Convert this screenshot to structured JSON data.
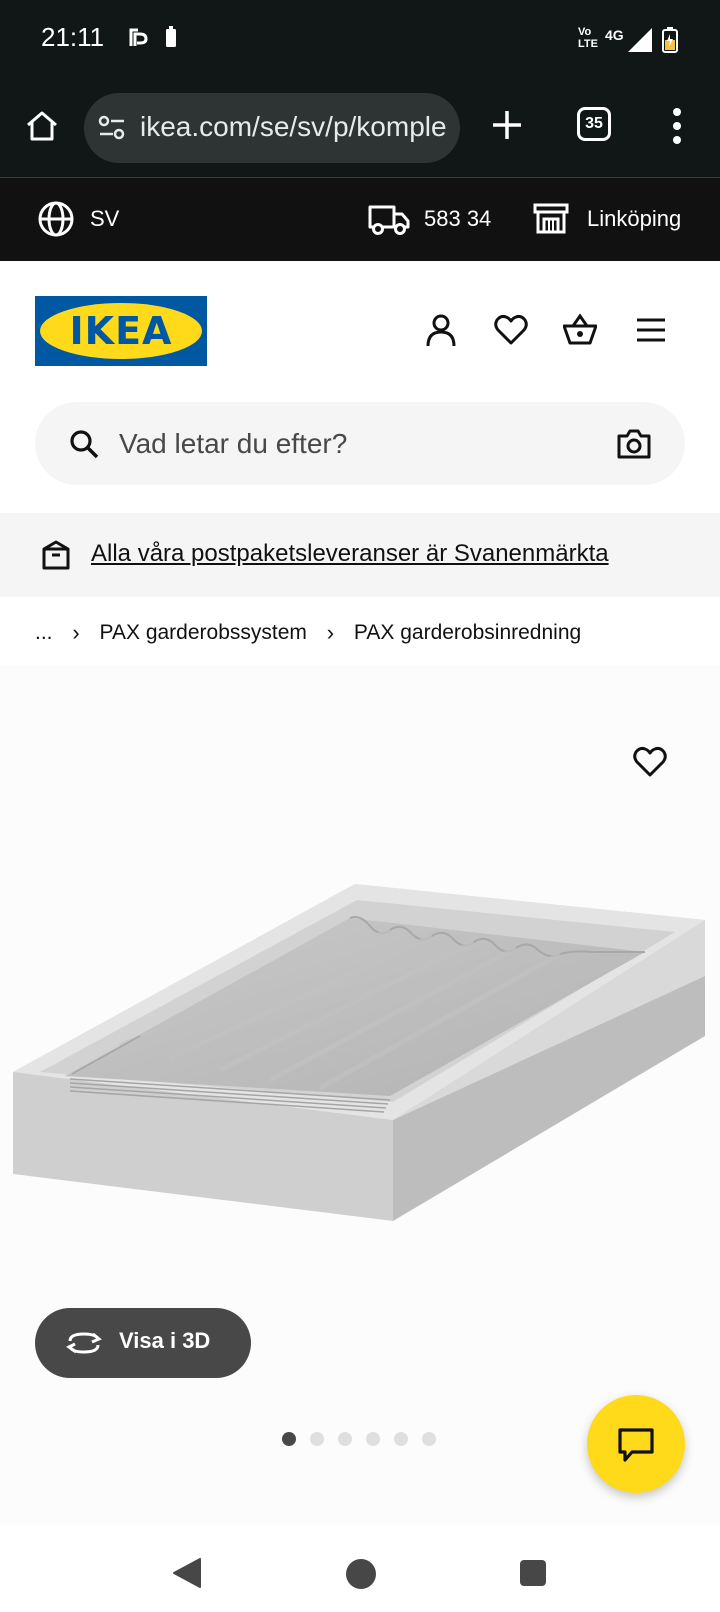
{
  "status_bar": {
    "time": "21:11",
    "volte": "Vo LTE",
    "network": "4G",
    "icons": [
      "app-notification-icon",
      "small-battery-icon",
      "signal-icon",
      "battery-charging-icon"
    ]
  },
  "browser": {
    "url": "ikea.com/se/sv/p/komple",
    "tab_count": "35",
    "icons": [
      "home-icon",
      "site-settings-icon",
      "plus-icon",
      "more-vert-icon"
    ]
  },
  "location_bar": {
    "language": "SV",
    "postal_code": "583 34",
    "store": "Linköping"
  },
  "header": {
    "logo_text": "IKEA",
    "icons": [
      "account-icon",
      "heart-icon",
      "basket-icon",
      "hamburger-icon"
    ]
  },
  "search": {
    "placeholder": "Vad letar du efter?"
  },
  "banner": {
    "text": "Alla våra postpaketsleveranser är Svanenmärkta"
  },
  "breadcrumb": {
    "items": [
      "...",
      "PAX garderobssystem",
      "PAX garderobsinredning"
    ],
    "separator": "›"
  },
  "product": {
    "view_3d_label": "Visa i 3D",
    "image_count": 6,
    "active_image": 1
  },
  "colors": {
    "ikea_blue": "#0058a3",
    "ikea_yellow": "#ffda1a",
    "dark_bar": "#111111",
    "button_gray": "#484848"
  }
}
